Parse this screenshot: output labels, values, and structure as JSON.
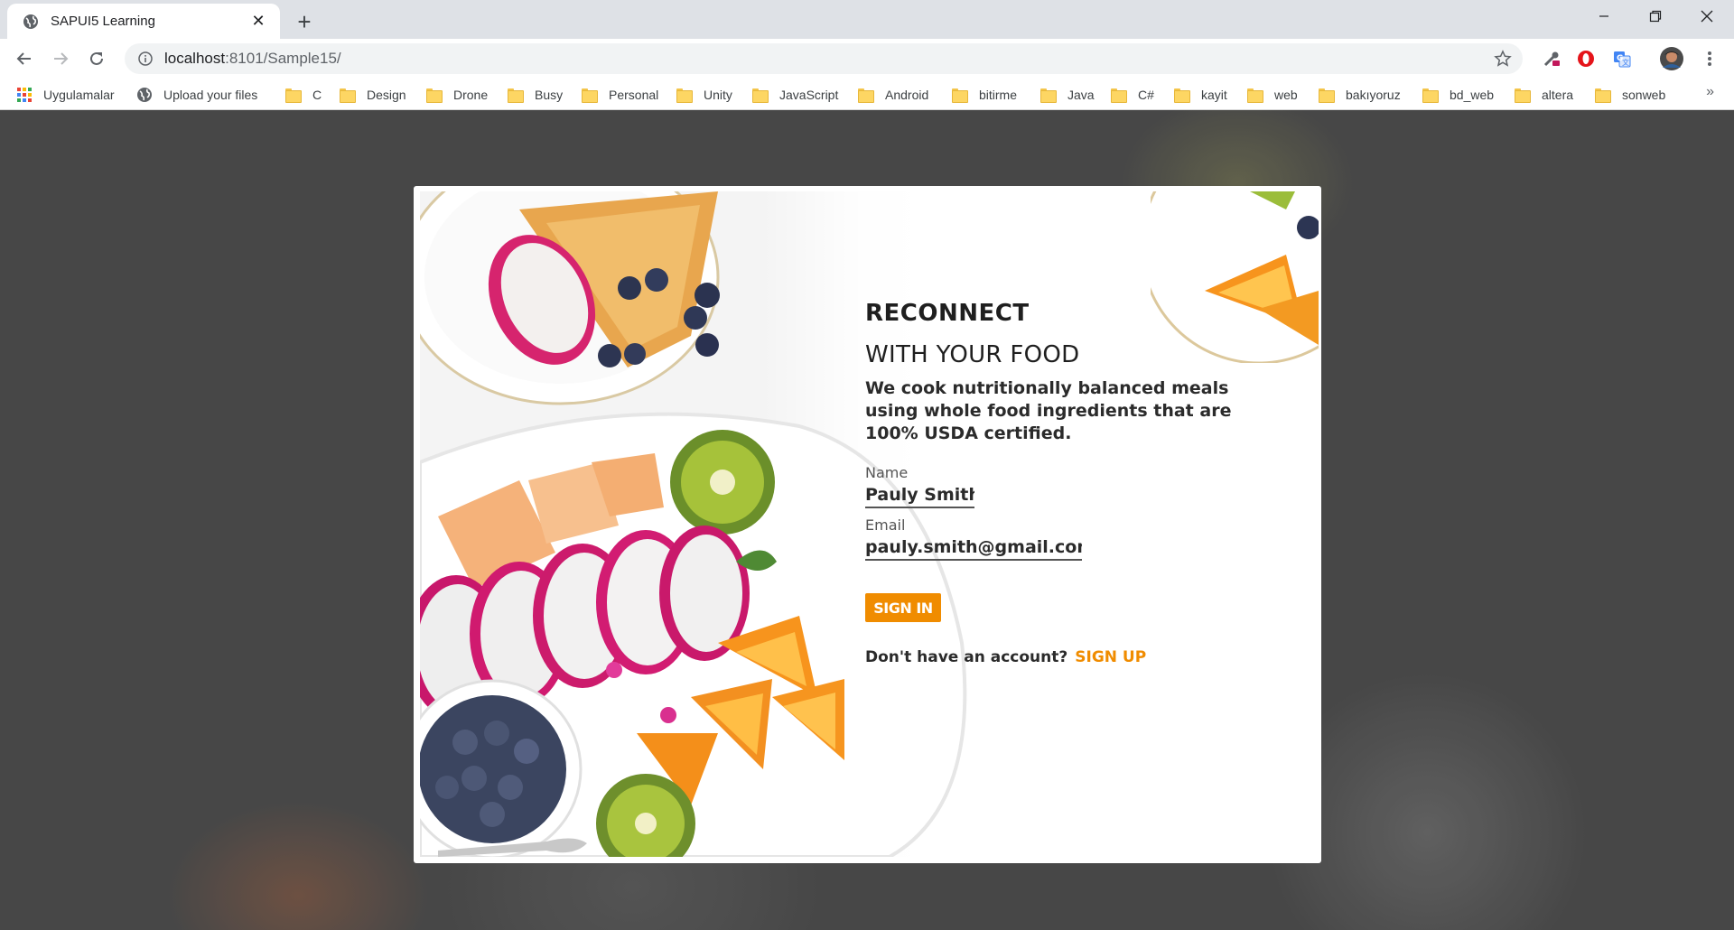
{
  "browser": {
    "tab": {
      "title": "SAPUI5 Learning",
      "favicon": "globe-icon"
    },
    "address": {
      "host": "localhost",
      "path": ":8101/Sample15/"
    },
    "bookmarks": [
      {
        "label": "Uygulamalar",
        "icon": "apps-grid-icon"
      },
      {
        "label": "Upload your files",
        "icon": "globe-icon"
      },
      {
        "label": "C",
        "icon": "folder-icon"
      },
      {
        "label": "Design",
        "icon": "folder-icon"
      },
      {
        "label": "Drone",
        "icon": "folder-icon"
      },
      {
        "label": "Busy",
        "icon": "folder-icon"
      },
      {
        "label": "Personal",
        "icon": "folder-icon"
      },
      {
        "label": "Unity",
        "icon": "folder-icon"
      },
      {
        "label": "JavaScript",
        "icon": "folder-icon"
      },
      {
        "label": "Android",
        "icon": "folder-icon"
      },
      {
        "label": "bitirme",
        "icon": "folder-icon"
      },
      {
        "label": "Java",
        "icon": "folder-icon"
      },
      {
        "label": "C#",
        "icon": "folder-icon"
      },
      {
        "label": "kayit",
        "icon": "folder-icon"
      },
      {
        "label": "web",
        "icon": "folder-icon"
      },
      {
        "label": "bakıyoruz",
        "icon": "folder-icon"
      },
      {
        "label": "bd_web",
        "icon": "folder-icon"
      },
      {
        "label": "altera",
        "icon": "folder-icon"
      },
      {
        "label": "sonweb",
        "icon": "folder-icon"
      }
    ],
    "more_bookmarks": "»"
  },
  "login": {
    "title_line1": "RECONNECT",
    "title_line2": "WITH YOUR FOOD",
    "subtitle": "We cook nutritionally balanced meals using whole food ingredients that are 100% USDA certified.",
    "name_label": "Name",
    "name_value": "Pauly Smith",
    "email_label": "Email",
    "email_value": "pauly.smith@gmail.com",
    "signin_label": "SIGN IN",
    "signup_prompt": "Don't have an account?",
    "signup_link": "SIGN UP"
  },
  "colors": {
    "accent": "#f08c00",
    "text": "#2b2b2b",
    "overlay": "#505050"
  }
}
